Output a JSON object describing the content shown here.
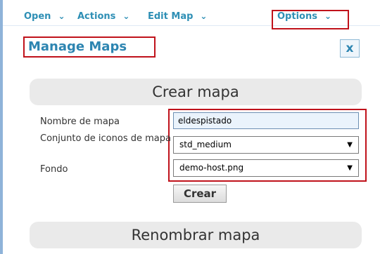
{
  "menu": {
    "items": [
      {
        "label": "Open",
        "chevron": "chevron-down-icon"
      },
      {
        "label": "Actions",
        "chevron": "chevron-down-icon"
      },
      {
        "label": "Edit Map",
        "chevron": "chevron-down-icon"
      },
      {
        "label": "Options",
        "chevron": "chevron-down-icon"
      }
    ],
    "chevron_glyph": "⌄"
  },
  "dialog": {
    "title": "Manage Maps",
    "close_label": "x"
  },
  "create_section": {
    "header": "Crear mapa",
    "name_label": "Nombre de mapa",
    "name_value": "eldespistado",
    "iconset_label": "Conjunto de iconos de mapa",
    "iconset_value": "std_medium",
    "background_label": "Fondo",
    "background_value": "demo-host.png",
    "submit_label": "Crear"
  },
  "rename_section": {
    "header": "Renombrar mapa"
  },
  "colors": {
    "accent": "#2e8fb5",
    "highlight": "#c0121b",
    "section_bg": "#eaeaea"
  }
}
